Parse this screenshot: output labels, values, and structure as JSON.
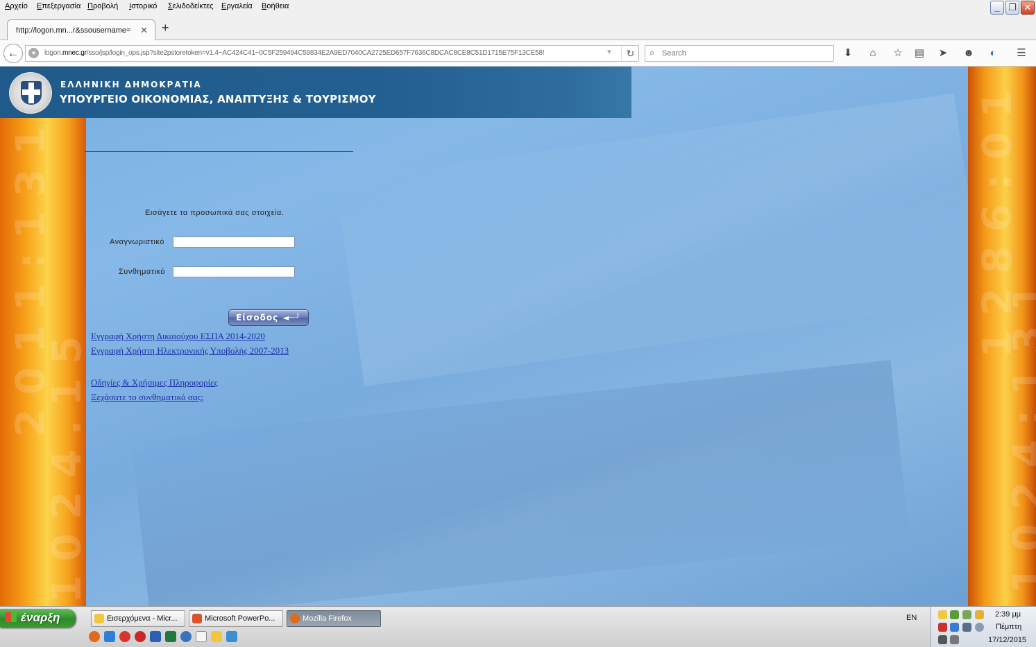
{
  "menu": [
    "Αρχείο",
    "Επεξεργασία",
    "Προβολή",
    "Ιστορικό",
    "Σελιδοδείκτες",
    "Εργαλεία",
    "Βοήθεια"
  ],
  "tab": {
    "title": "http://logon.mn...r&ssousername="
  },
  "address": {
    "prefix": "logon.",
    "domain": "mnec.gr",
    "rest": "/sso/jsp/login_ops.jsp?site2pstoretoken=v1.4~AC424C41~0C5F259494C59834E2A9ED7040CA2725ED657F7636C8DCAC8CE8C51D1715E75F13CE58!"
  },
  "search": {
    "placeholder": "Search"
  },
  "header": {
    "line1": "ΕΛΛΗΝΙΚΗ ΔΗΜΟΚΡΑΤΙΑ",
    "line2": "ΥΠΟΥΡΓΕΙΟ ΟΙΚΟΝΟΜΙΑΣ, ΑΝΑΠΤΥΞΗΣ & ΤΟΥΡΙΣΜΟΥ"
  },
  "form": {
    "intro": "Εισάγετε τα προσωπικά σας στοιχεία.",
    "username_label": "Αναγνωριστικό",
    "username_value": "",
    "password_label": "Συνθηματικό",
    "password_value": "",
    "login_label": "Είσοδος"
  },
  "links": [
    "Εγγραφή Χρήστη Δικαιούχου ΕΣΠΑ 2014-2020",
    "Εγγραφή Χρήστη Ηλεκτρονικής Υποβολής 2007-2013",
    "Οδηγίες & Χρήσιμες Πληροφορίες",
    "Ξεχάσατε το συνθηματικό σας;"
  ],
  "taskbar": {
    "start_label": "έναρξη",
    "tasks": [
      "Εισερχόμενα - Micr...",
      "Microsoft PowerPo...",
      "Mozilla Firefox"
    ],
    "lang": "EN",
    "time": "2:39 μμ",
    "day": "Πέμπτη",
    "date": "17/12/2015"
  },
  "colors": {
    "header_blue": "#235f90",
    "page_blue": "#86b9e8",
    "link_blue": "#1a2ea8",
    "start_green": "#2f8a2a"
  }
}
